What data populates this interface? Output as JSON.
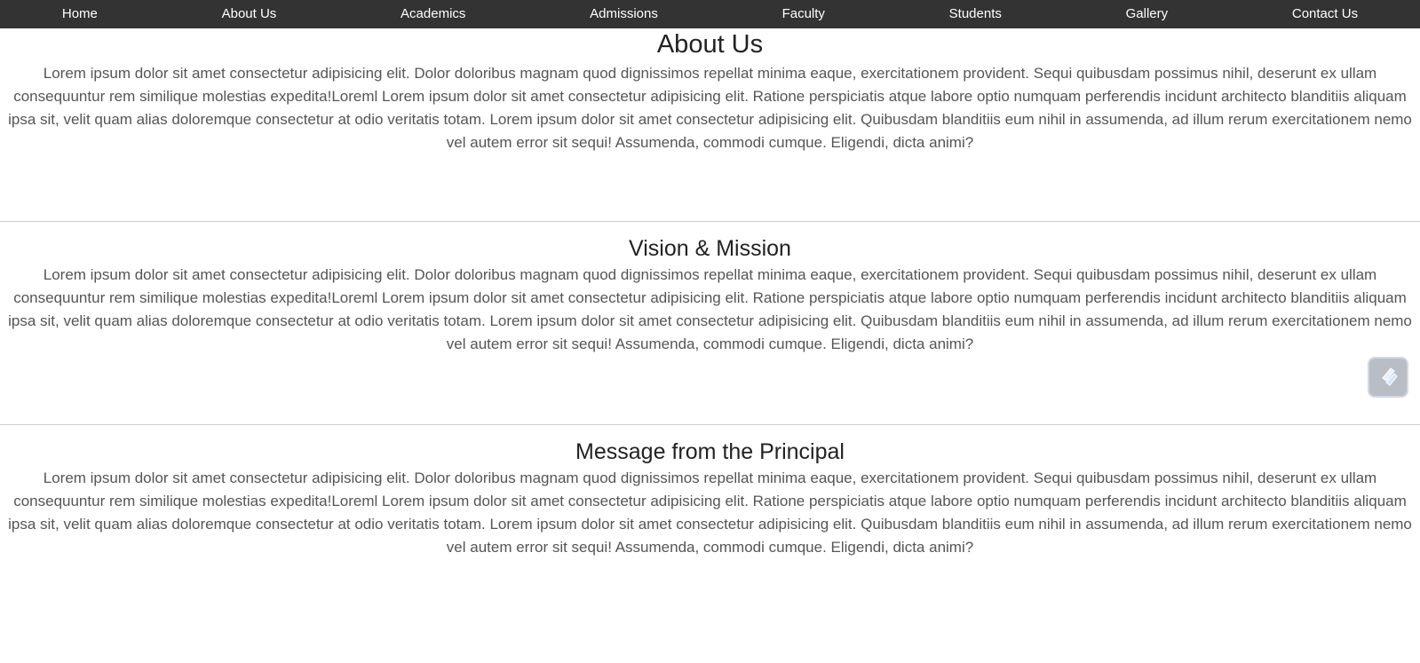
{
  "nav": {
    "items": [
      {
        "label": "Home"
      },
      {
        "label": "About Us"
      },
      {
        "label": "Academics"
      },
      {
        "label": "Admissions"
      },
      {
        "label": "Faculty"
      },
      {
        "label": "Students"
      },
      {
        "label": "Gallery"
      },
      {
        "label": "Contact Us"
      }
    ]
  },
  "sections": [
    {
      "title": "About Us",
      "body": "Lorem ipsum dolor sit amet consectetur adipisicing elit. Dolor doloribus magnam quod dignissimos repellat minima eaque, exercitationem provident. Sequi quibusdam possimus nihil, deserunt ex ullam consequuntur rem similique molestias expedita!Loreml Lorem ipsum dolor sit amet consectetur adipisicing elit. Ratione perspiciatis atque labore optio numquam perferendis incidunt architecto blanditiis aliquam ipsa sit, velit quam alias doloremque consectetur at odio veritatis totam. Lorem ipsum dolor sit amet consectetur adipisicing elit. Quibusdam blanditiis eum nihil in assumenda, ad illum rerum exercitationem nemo vel autem error sit sequi! Assumenda, commodi cumque. Eligendi, dicta animi?"
    },
    {
      "title": "Vision & Mission",
      "body": "Lorem ipsum dolor sit amet consectetur adipisicing elit. Dolor doloribus magnam quod dignissimos repellat minima eaque, exercitationem provident. Sequi quibusdam possimus nihil, deserunt ex ullam consequuntur rem similique molestias expedita!Loreml Lorem ipsum dolor sit amet consectetur adipisicing elit. Ratione perspiciatis atque labore optio numquam perferendis incidunt architecto blanditiis aliquam ipsa sit, velit quam alias doloremque consectetur at odio veritatis totam. Lorem ipsum dolor sit amet consectetur adipisicing elit. Quibusdam blanditiis eum nihil in assumenda, ad illum rerum exercitationem nemo vel autem error sit sequi! Assumenda, commodi cumque. Eligendi, dicta animi?"
    },
    {
      "title": "Message from the Principal",
      "body": "Lorem ipsum dolor sit amet consectetur adipisicing elit. Dolor doloribus magnam quod dignissimos repellat minima eaque, exercitationem provident. Sequi quibusdam possimus nihil, deserunt ex ullam consequuntur rem similique molestias expedita!Loreml Lorem ipsum dolor sit amet consectetur adipisicing elit. Ratione perspiciatis atque labore optio numquam perferendis incidunt architecto blanditiis aliquam ipsa sit, velit quam alias doloremque consectetur at odio veritatis totam. Lorem ipsum dolor sit amet consectetur adipisicing elit. Quibusdam blanditiis eum nihil in assumenda, ad illum rerum exercitationem nemo vel autem error sit sequi! Assumenda, commodi cumque. Eligendi, dicta animi?"
    }
  ],
  "floating_button": {
    "icon": "pen-icon"
  },
  "colors": {
    "nav_background": "#333333",
    "nav_text": "#ffffff",
    "heading": "#222222",
    "body_text": "#555555",
    "divider": "#cccccc"
  }
}
